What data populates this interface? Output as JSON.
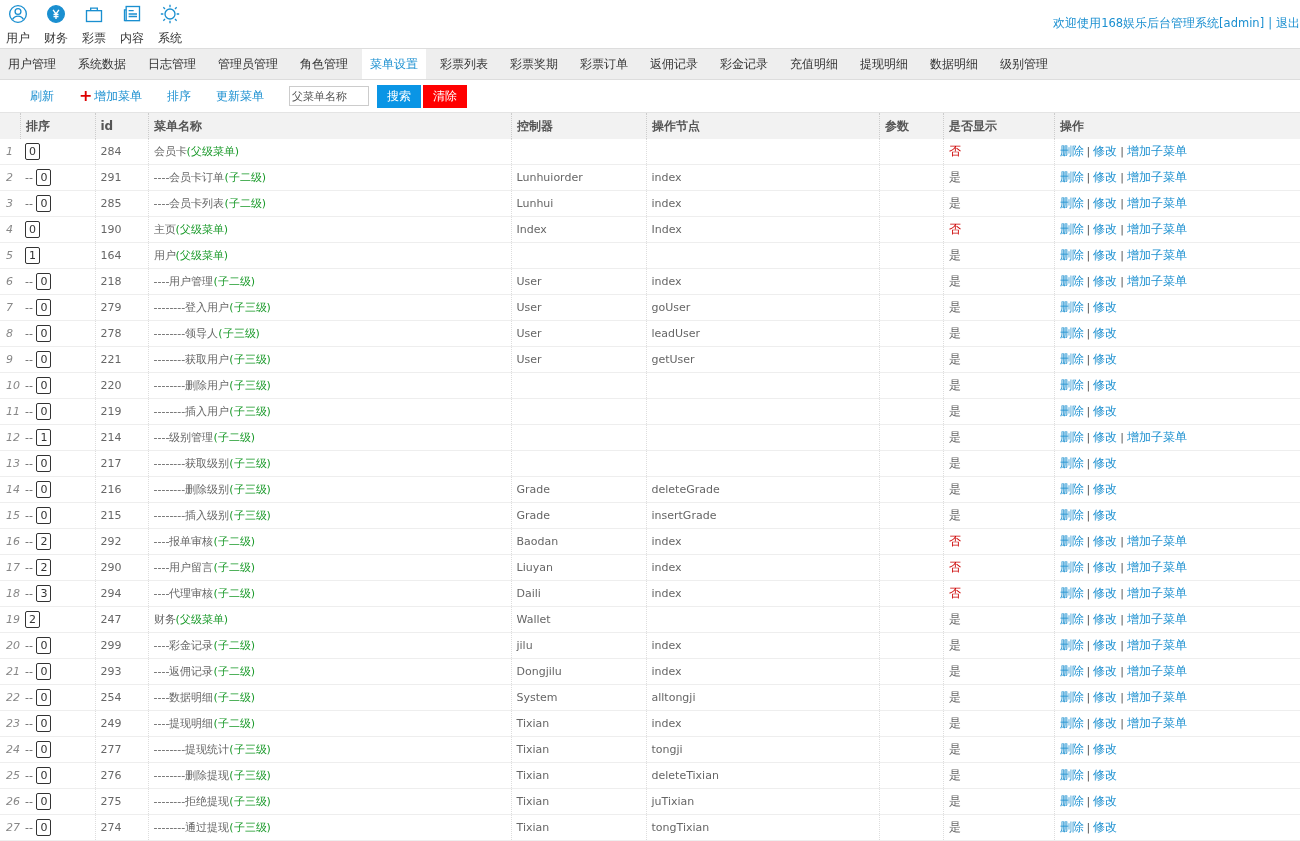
{
  "top_nav": [
    {
      "label": "用户"
    },
    {
      "label": "财务"
    },
    {
      "label": "彩票"
    },
    {
      "label": "内容"
    },
    {
      "label": "系统"
    }
  ],
  "welcome": "欢迎使用168娱乐后台管理系统[admin]",
  "header_separator": "|",
  "logout": "退出",
  "tabs": [
    {
      "label": "用户管理",
      "selected": false
    },
    {
      "label": "系统数据",
      "selected": false
    },
    {
      "label": "日志管理",
      "selected": false
    },
    {
      "label": "管理员管理",
      "selected": false
    },
    {
      "label": "角色管理",
      "selected": false
    },
    {
      "label": "菜单设置",
      "selected": true
    },
    {
      "label": "彩票列表",
      "selected": false
    },
    {
      "label": "彩票奖期",
      "selected": false
    },
    {
      "label": "彩票订单",
      "selected": false
    },
    {
      "label": "返佣记录",
      "selected": false
    },
    {
      "label": "彩金记录",
      "selected": false
    },
    {
      "label": "充值明细",
      "selected": false
    },
    {
      "label": "提现明细",
      "selected": false
    },
    {
      "label": "数据明细",
      "selected": false
    },
    {
      "label": "级别管理",
      "selected": false
    }
  ],
  "toolbar": {
    "refresh": "刷新",
    "add_icon": "+",
    "add": "增加菜单",
    "sort": "排序",
    "update": "更新菜单",
    "search": {
      "placeholder": "父菜单名称"
    },
    "search_button": "搜索",
    "clear_button": "清除"
  },
  "table": {
    "columns": [
      "排序",
      "id",
      "菜单名称",
      "控制器",
      "操作节点",
      "参数",
      "是否显示",
      "操作"
    ],
    "action_separator": "|",
    "rows": [
      {
        "no": "1",
        "prefix": "",
        "sort": "0",
        "id": "284",
        "name": "会员卡",
        "tag": "(父级菜单)",
        "controller": "",
        "node": "",
        "show": "否",
        "visible": false,
        "actions": [
          "删除",
          "修改",
          "增加子菜单"
        ]
      },
      {
        "no": "2",
        "prefix": "--",
        "sort": "0",
        "id": "291",
        "name": "----会员卡订单",
        "tag": "(子二级)",
        "controller": "Lunhuiorder",
        "node": "index",
        "show": "是",
        "visible": true,
        "actions": [
          "删除",
          "修改",
          "增加子菜单"
        ]
      },
      {
        "no": "3",
        "prefix": "--",
        "sort": "0",
        "id": "285",
        "name": "----会员卡列表",
        "tag": "(子二级)",
        "controller": "Lunhui",
        "node": "index",
        "show": "是",
        "visible": true,
        "actions": [
          "删除",
          "修改",
          "增加子菜单"
        ]
      },
      {
        "no": "4",
        "prefix": "",
        "sort": "0",
        "id": "190",
        "name": "主页",
        "tag": "(父级菜单)",
        "controller": "Index",
        "node": "Index",
        "show": "否",
        "visible": false,
        "actions": [
          "删除",
          "修改",
          "增加子菜单"
        ]
      },
      {
        "no": "5",
        "prefix": "",
        "sort": "1",
        "id": "164",
        "name": "用户",
        "tag": "(父级菜单)",
        "controller": "",
        "node": "",
        "show": "是",
        "visible": true,
        "actions": [
          "删除",
          "修改",
          "增加子菜单"
        ]
      },
      {
        "no": "6",
        "prefix": "--",
        "sort": "0",
        "id": "218",
        "name": "----用户管理",
        "tag": "(子二级)",
        "controller": "User",
        "node": "index",
        "show": "是",
        "visible": true,
        "actions": [
          "删除",
          "修改",
          "增加子菜单"
        ]
      },
      {
        "no": "7",
        "prefix": "--",
        "sort": "0",
        "id": "279",
        "name": "--------登入用户",
        "tag": "(子三级)",
        "controller": "User",
        "node": "goUser",
        "show": "是",
        "visible": true,
        "actions": [
          "删除",
          "修改"
        ]
      },
      {
        "no": "8",
        "prefix": "--",
        "sort": "0",
        "id": "278",
        "name": "--------领导人",
        "tag": "(子三级)",
        "controller": "User",
        "node": "leadUser",
        "show": "是",
        "visible": true,
        "actions": [
          "删除",
          "修改"
        ]
      },
      {
        "no": "9",
        "prefix": "--",
        "sort": "0",
        "id": "221",
        "name": "--------获取用户",
        "tag": "(子三级)",
        "controller": "User",
        "node": "getUser",
        "show": "是",
        "visible": true,
        "actions": [
          "删除",
          "修改"
        ]
      },
      {
        "no": "10",
        "prefix": "--",
        "sort": "0",
        "id": "220",
        "name": "--------删除用户",
        "tag": "(子三级)",
        "controller": "",
        "node": "",
        "show": "是",
        "visible": true,
        "actions": [
          "删除",
          "修改"
        ]
      },
      {
        "no": "11",
        "prefix": "--",
        "sort": "0",
        "id": "219",
        "name": "--------插入用户",
        "tag": "(子三级)",
        "controller": "",
        "node": "",
        "show": "是",
        "visible": true,
        "actions": [
          "删除",
          "修改"
        ]
      },
      {
        "no": "12",
        "prefix": "--",
        "sort": "1",
        "id": "214",
        "name": "----级别管理",
        "tag": "(子二级)",
        "controller": "",
        "node": "",
        "show": "是",
        "visible": true,
        "actions": [
          "删除",
          "修改",
          "增加子菜单"
        ]
      },
      {
        "no": "13",
        "prefix": "--",
        "sort": "0",
        "id": "217",
        "name": "--------获取级别",
        "tag": "(子三级)",
        "controller": "",
        "node": "",
        "show": "是",
        "visible": true,
        "actions": [
          "删除",
          "修改"
        ]
      },
      {
        "no": "14",
        "prefix": "--",
        "sort": "0",
        "id": "216",
        "name": "--------删除级别",
        "tag": "(子三级)",
        "controller": "Grade",
        "node": "deleteGrade",
        "show": "是",
        "visible": true,
        "actions": [
          "删除",
          "修改"
        ]
      },
      {
        "no": "15",
        "prefix": "--",
        "sort": "0",
        "id": "215",
        "name": "--------插入级别",
        "tag": "(子三级)",
        "controller": "Grade",
        "node": "insertGrade",
        "show": "是",
        "visible": true,
        "actions": [
          "删除",
          "修改"
        ]
      },
      {
        "no": "16",
        "prefix": "--",
        "sort": "2",
        "id": "292",
        "name": "----报单审核",
        "tag": "(子二级)",
        "controller": "Baodan",
        "node": "index",
        "show": "否",
        "visible": false,
        "actions": [
          "删除",
          "修改",
          "增加子菜单"
        ]
      },
      {
        "no": "17",
        "prefix": "--",
        "sort": "2",
        "id": "290",
        "name": "----用户留言",
        "tag": "(子二级)",
        "controller": "Liuyan",
        "node": "index",
        "show": "否",
        "visible": false,
        "actions": [
          "删除",
          "修改",
          "增加子菜单"
        ]
      },
      {
        "no": "18",
        "prefix": "--",
        "sort": "3",
        "id": "294",
        "name": "----代理审核",
        "tag": "(子二级)",
        "controller": "Daili",
        "node": "index",
        "show": "否",
        "visible": false,
        "actions": [
          "删除",
          "修改",
          "增加子菜单"
        ]
      },
      {
        "no": "19",
        "prefix": "",
        "sort": "2",
        "id": "247",
        "name": "财务",
        "tag": "(父级菜单)",
        "controller": "Wallet",
        "node": "",
        "show": "是",
        "visible": true,
        "actions": [
          "删除",
          "修改",
          "增加子菜单"
        ]
      },
      {
        "no": "20",
        "prefix": "--",
        "sort": "0",
        "id": "299",
        "name": "----彩金记录",
        "tag": "(子二级)",
        "controller": "jilu",
        "node": "index",
        "show": "是",
        "visible": true,
        "actions": [
          "删除",
          "修改",
          "增加子菜单"
        ]
      },
      {
        "no": "21",
        "prefix": "--",
        "sort": "0",
        "id": "293",
        "name": "----返佣记录",
        "tag": "(子二级)",
        "controller": "Dongjilu",
        "node": "index",
        "show": "是",
        "visible": true,
        "actions": [
          "删除",
          "修改",
          "增加子菜单"
        ]
      },
      {
        "no": "22",
        "prefix": "--",
        "sort": "0",
        "id": "254",
        "name": "----数据明细",
        "tag": "(子二级)",
        "controller": "System",
        "node": "alltongji",
        "show": "是",
        "visible": true,
        "actions": [
          "删除",
          "修改",
          "增加子菜单"
        ]
      },
      {
        "no": "23",
        "prefix": "--",
        "sort": "0",
        "id": "249",
        "name": "----提现明细",
        "tag": "(子二级)",
        "controller": "Tixian",
        "node": "index",
        "show": "是",
        "visible": true,
        "actions": [
          "删除",
          "修改",
          "增加子菜单"
        ]
      },
      {
        "no": "24",
        "prefix": "--",
        "sort": "0",
        "id": "277",
        "name": "--------提现统计",
        "tag": "(子三级)",
        "controller": "Tixian",
        "node": "tongji",
        "show": "是",
        "visible": true,
        "actions": [
          "删除",
          "修改"
        ]
      },
      {
        "no": "25",
        "prefix": "--",
        "sort": "0",
        "id": "276",
        "name": "--------删除提现",
        "tag": "(子三级)",
        "controller": "Tixian",
        "node": "deleteTixian",
        "show": "是",
        "visible": true,
        "actions": [
          "删除",
          "修改"
        ]
      },
      {
        "no": "26",
        "prefix": "--",
        "sort": "0",
        "id": "275",
        "name": "--------拒绝提现",
        "tag": "(子三级)",
        "controller": "Tixian",
        "node": "juTixian",
        "show": "是",
        "visible": true,
        "actions": [
          "删除",
          "修改"
        ]
      },
      {
        "no": "27",
        "prefix": "--",
        "sort": "0",
        "id": "274",
        "name": "--------通过提现",
        "tag": "(子三级)",
        "controller": "Tixian",
        "node": "tongTixian",
        "show": "是",
        "visible": true,
        "actions": [
          "删除",
          "修改"
        ]
      }
    ]
  }
}
